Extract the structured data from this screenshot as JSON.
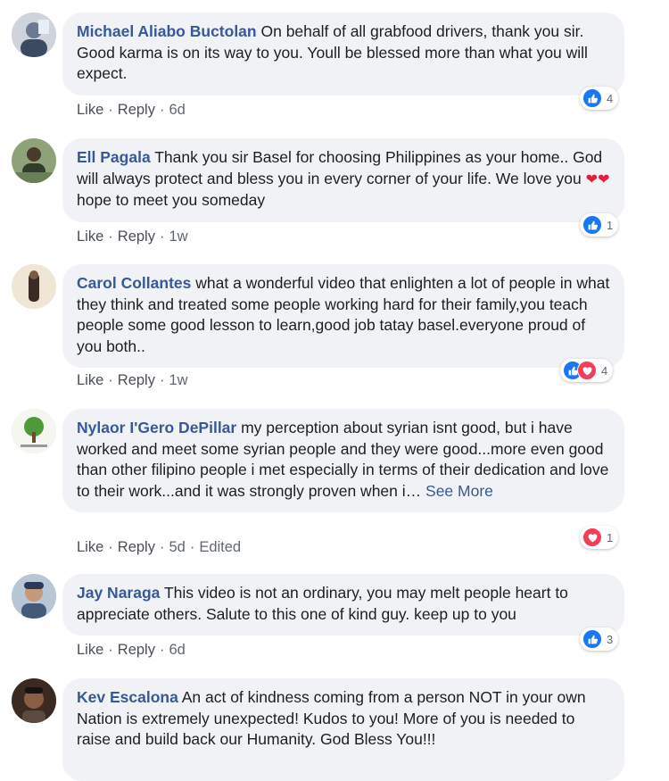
{
  "comments": [
    {
      "author": "Michael Aliabo Buctolan",
      "text": "On behalf of all grabfood drivers, thank you sir. Good karma is on its way to you. Youll be blessed more than what you will expect.",
      "actions": {
        "like": "Like",
        "reply": "Reply",
        "time": "6d"
      },
      "reaction_count": "4"
    },
    {
      "author": "Ell Pagala",
      "text": "Thank you sir Basel for choosing Philippines as your home.. God will always protect and bless you in every corner of your life. We love you",
      "heart_glyphs": "❤❤",
      "text_after": "hope to meet you someday",
      "actions": {
        "like": "Like",
        "reply": "Reply",
        "time": "1w"
      },
      "reaction_count": "1"
    },
    {
      "author": "Carol Collantes",
      "text": "what a wonderful video that enlighten a lot of people in what they think and treated some people working hard for their family,you teach people some good lesson to learn,good job tatay basel.everyone proud of you both..",
      "actions": {
        "like": "Like",
        "reply": "Reply",
        "time": "1w"
      },
      "reaction_count": "4"
    },
    {
      "author": "Nylaor I'Gero DePillar",
      "text": "my perception about syrian isnt good, but i have worked and meet some syrian people and they were good...more even good than other filipino people i met especially in terms of their dedication and love to their work...and it was strongly proven when i…",
      "see_more": "See More",
      "actions": {
        "like": "Like",
        "reply": "Reply",
        "time": "5d",
        "edited": "Edited"
      },
      "reaction_count": "1"
    },
    {
      "author": "Jay Naraga",
      "text": "This video is not an ordinary, you may melt people heart to appreciate others. Salute to this one of kind guy. keep up to you",
      "actions": {
        "like": "Like",
        "reply": "Reply",
        "time": "6d"
      },
      "reaction_count": "3"
    },
    {
      "author": "Kev Escalona",
      "text": "An act of kindness coming from a person NOT in your own Nation is extremely unexpected! Kudos to you! More of you is needed to raise and build back our Humanity. God Bless You!!!"
    }
  ],
  "colors": {
    "name": "#385898",
    "bubble": "#f0f2f5",
    "like": "#1877f2",
    "love": "#f33e58",
    "meta": "#606770"
  },
  "icons": {
    "like": "thumbs-up-icon",
    "love": "heart-icon"
  }
}
